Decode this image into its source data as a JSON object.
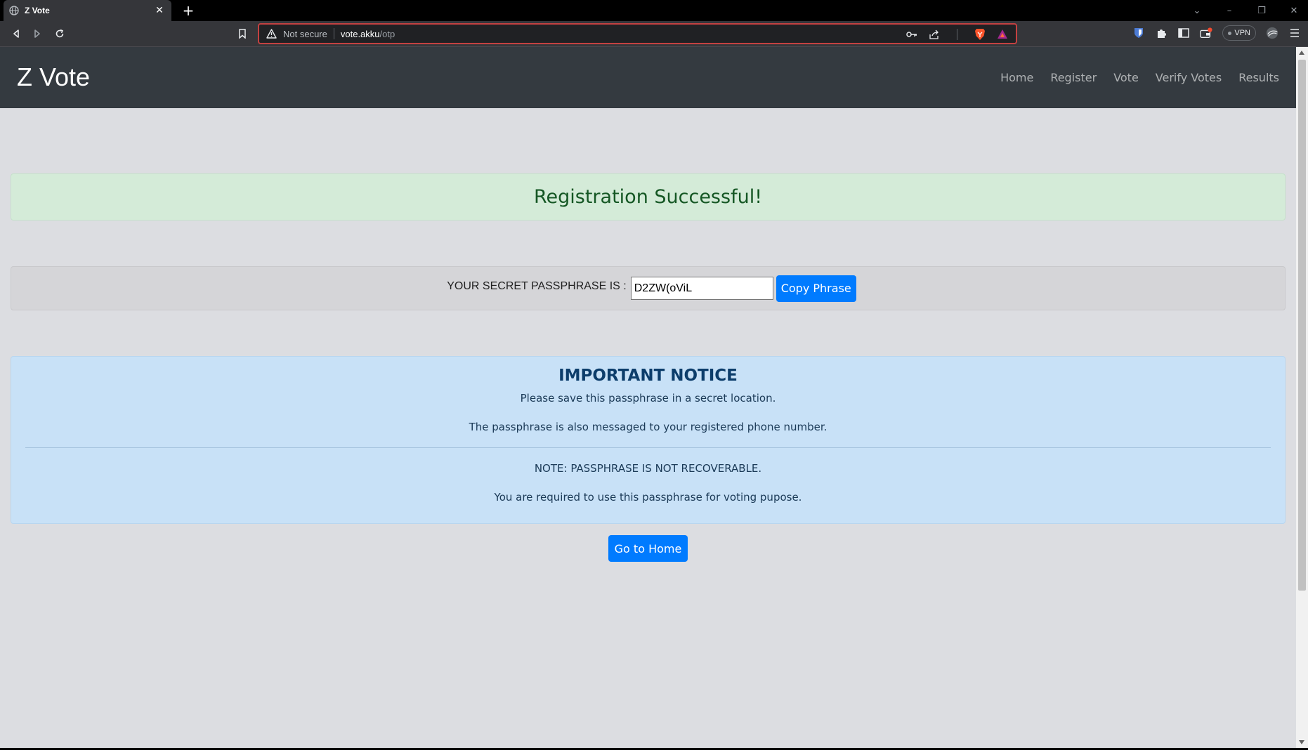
{
  "browser": {
    "tab_title": "Z Vote",
    "tab_close": "✕",
    "new_tab": "+",
    "address": {
      "security_label": "Not secure",
      "host": "vote.akku",
      "path": "/otp"
    },
    "vpn_label": "VPN"
  },
  "navbar": {
    "brand": "Z Vote",
    "links": [
      "Home",
      "Register",
      "Vote",
      "Verify Votes",
      "Results"
    ]
  },
  "success": {
    "heading": "Registration Successful!"
  },
  "passphrase": {
    "label": "YOUR SECRET PASSPHRASE IS :",
    "value": "D2ZW(oViL",
    "copy_button": "Copy Phrase"
  },
  "notice": {
    "heading": "IMPORTANT NOTICE",
    "line1": "Please save this passphrase in a secret location.",
    "line2": "The passphrase is also messaged to your registered phone number.",
    "line3": "NOTE: PASSPHRASE IS NOT RECOVERABLE.",
    "line4": "You are required to use this passphrase for voting pupose."
  },
  "home_button": "Go to Home",
  "colors": {
    "navbar_bg": "#343a40",
    "primary": "#007bff",
    "success_bg": "#d4ebd8",
    "success_text": "#155724",
    "info_bg": "#c8e1f7",
    "page_bg": "#dcdde1"
  }
}
